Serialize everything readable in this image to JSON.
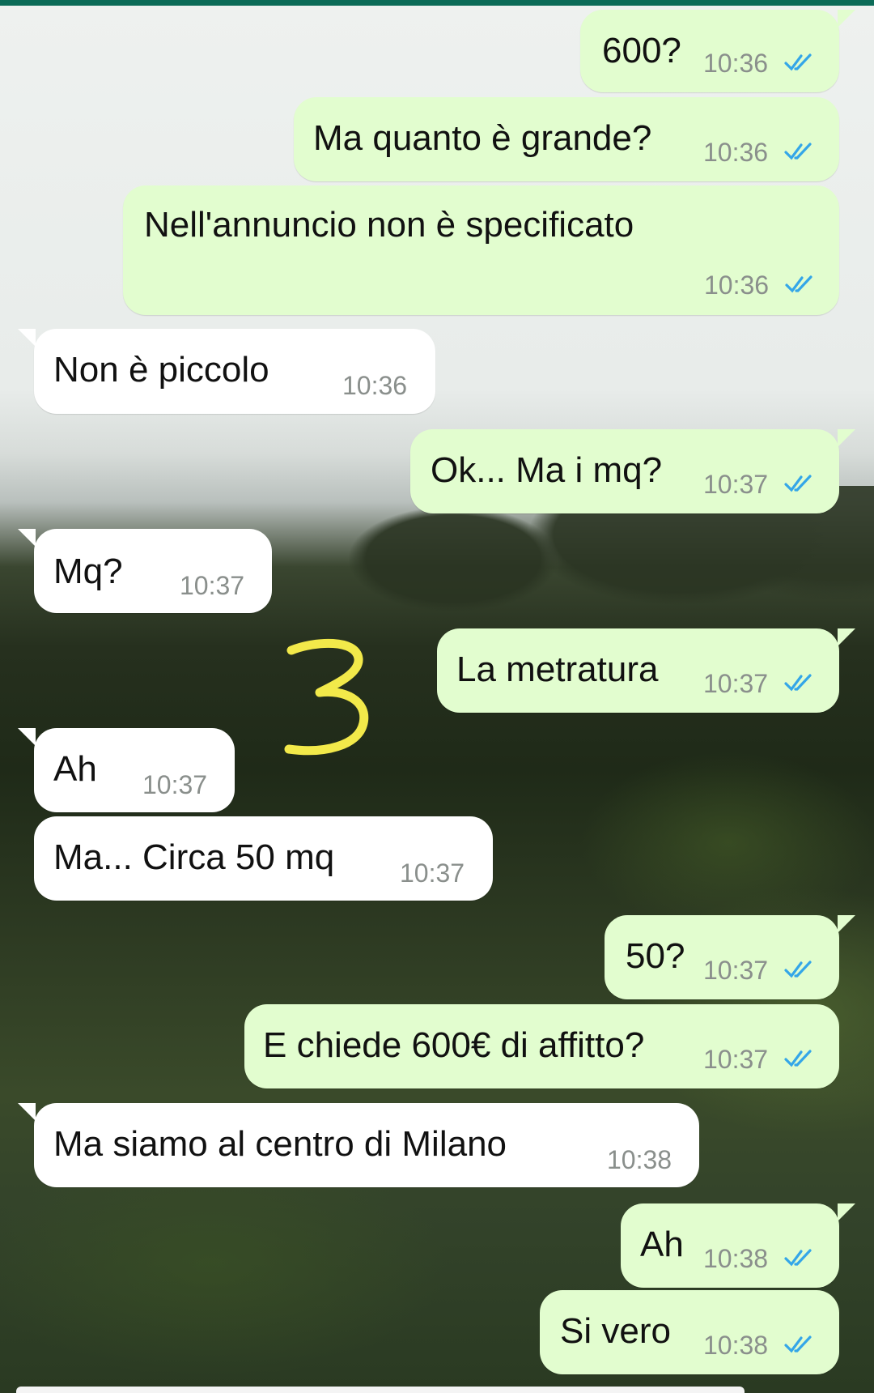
{
  "messages": [
    {
      "text": "600?",
      "time": "10:36",
      "dir": "out",
      "status": "read"
    },
    {
      "text": "Ma quanto è grande?",
      "time": "10:36",
      "dir": "out",
      "status": "read"
    },
    {
      "text": "Nell'annuncio non è specificato",
      "time": "10:36",
      "dir": "out",
      "status": "read"
    },
    {
      "text": "Non è piccolo",
      "time": "10:36",
      "dir": "in"
    },
    {
      "text": "Ok... Ma i mq?",
      "time": "10:37",
      "dir": "out",
      "status": "read"
    },
    {
      "text": "Mq?",
      "time": "10:37",
      "dir": "in"
    },
    {
      "text": "La metratura",
      "time": "10:37",
      "dir": "out",
      "status": "read"
    },
    {
      "text": "Ah",
      "time": "10:37",
      "dir": "in"
    },
    {
      "text": "Ma... Circa 50 mq",
      "time": "10:37",
      "dir": "in"
    },
    {
      "text": "50?",
      "time": "10:37",
      "dir": "out",
      "status": "read"
    },
    {
      "text": "E chiede 600€ di affitto?",
      "time": "10:37",
      "dir": "out",
      "status": "read"
    },
    {
      "text": "Ma siamo al centro di Milano",
      "time": "10:38",
      "dir": "in"
    },
    {
      "text": "Ah",
      "time": "10:38",
      "dir": "out",
      "status": "read"
    },
    {
      "text": "Si vero",
      "time": "10:38",
      "dir": "out",
      "status": "read"
    }
  ],
  "annotation": {
    "text": "3",
    "color": "#f2e94a"
  },
  "colors": {
    "outgoing_bubble": "#e2fdcf",
    "incoming_bubble": "#ffffff",
    "read_tick": "#34a6e8",
    "time_text": "#8a8f8c",
    "top_bar": "#0b6b57"
  },
  "icons": {
    "read_receipt": "double-check-icon"
  }
}
